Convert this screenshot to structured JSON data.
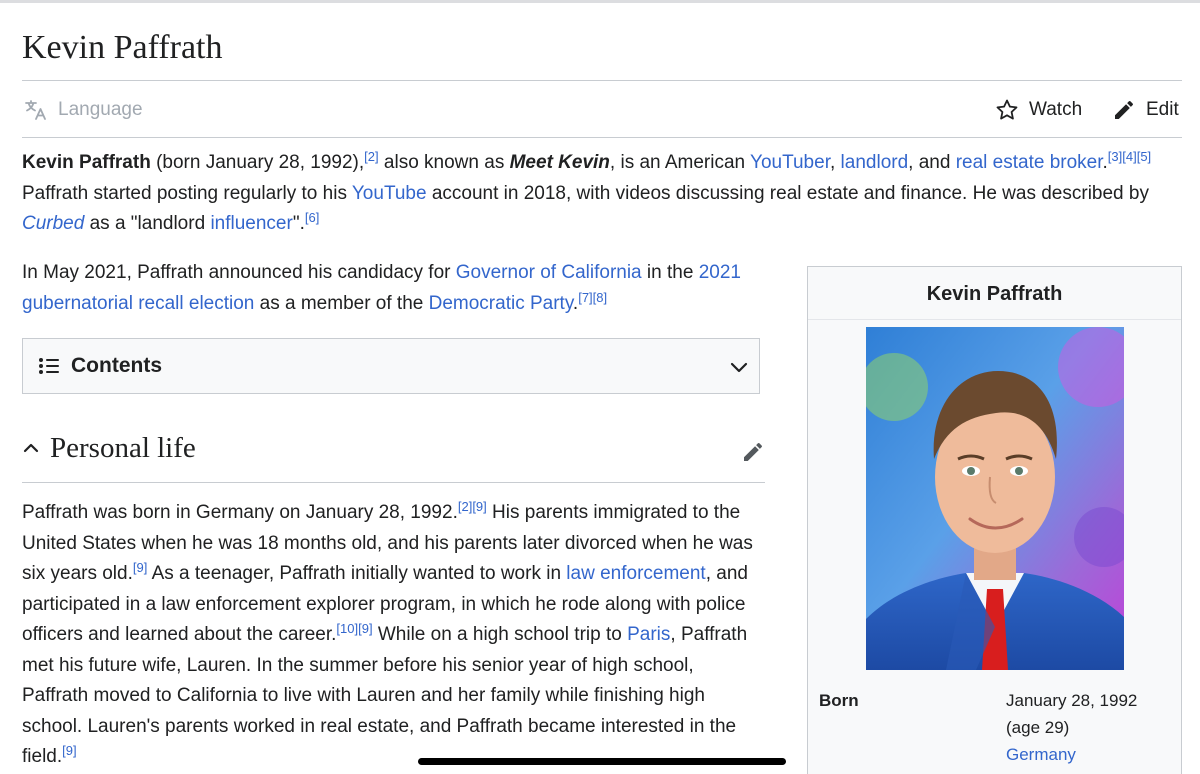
{
  "colors": {
    "link": "#3366cc",
    "text": "#202122",
    "muted": "#a2a9b1",
    "border": "#c8ccd1",
    "panel": "#f8f9fa"
  },
  "header": {
    "title": "Kevin Paffrath",
    "language_label": "Language",
    "watch_label": "Watch",
    "edit_label": "Edit",
    "icons": [
      "translate-icon",
      "star-icon",
      "pencil-icon"
    ]
  },
  "intro": {
    "name": "Kevin Paffrath",
    "t1": " (born January 28, 1992),",
    "ref1": "[2]",
    "t2": " also known as ",
    "nickname": "Meet Kevin",
    "t3": ", is an American ",
    "link_youtuber": "YouTuber",
    "comma1": ", ",
    "link_landlord": "landlord",
    "t4": ", and ",
    "link_broker": "real estate broker",
    "t5": ".",
    "ref2": "[3][4][5]",
    "t6": " Paffrath started posting regularly to his ",
    "link_youtube": "YouTube",
    "t7": " account in 2018, with videos discussing real estate and finance. He was described by ",
    "curbed": "Curbed",
    "t8": " as a \"landlord ",
    "link_influencer": "influencer",
    "t9": "\".",
    "ref3": "[6]"
  },
  "candidacy": {
    "t1": "In May 2021, Paffrath announced his candidacy for ",
    "link_governor": "Governor of California",
    "t2": " in the ",
    "link_recall": "2021 gubernatorial recall election",
    "t3": " as a member of the ",
    "link_party": "Democratic Party",
    "t4": ".",
    "ref": "[7][8]"
  },
  "contents": {
    "label": "Contents"
  },
  "personal_life": {
    "heading": "Personal life",
    "t1": "Paffrath was born in Germany on January 28, 1992.",
    "ref1": "[2][9]",
    "t2": " His parents immigrated to the United States when he was 18 months old, and his parents later divorced when he was six years old.",
    "ref2": "[9]",
    "t3": " As a teenager, Paffrath initially wanted to work in ",
    "link_law": "law enforcement",
    "t4": ", and participated in a law enforcement explorer program, in which he rode along with police officers and learned about the career.",
    "ref3": "[10][9]",
    "t5": " While on a high school trip to ",
    "link_paris": "Paris",
    "t6": ", Paffrath met his future wife, Lauren. In the summer before his senior year of high school, Paffrath moved to California to live with Lauren and her family while finishing high school. Lauren's parents worked in real estate, and Paffrath became interested in the field.",
    "ref4": "[9]"
  },
  "infobox": {
    "title": "Kevin Paffrath",
    "born_label": "Born",
    "born_date": "January 28, 1992",
    "born_age": "(age 29)",
    "born_place": "Germany"
  }
}
